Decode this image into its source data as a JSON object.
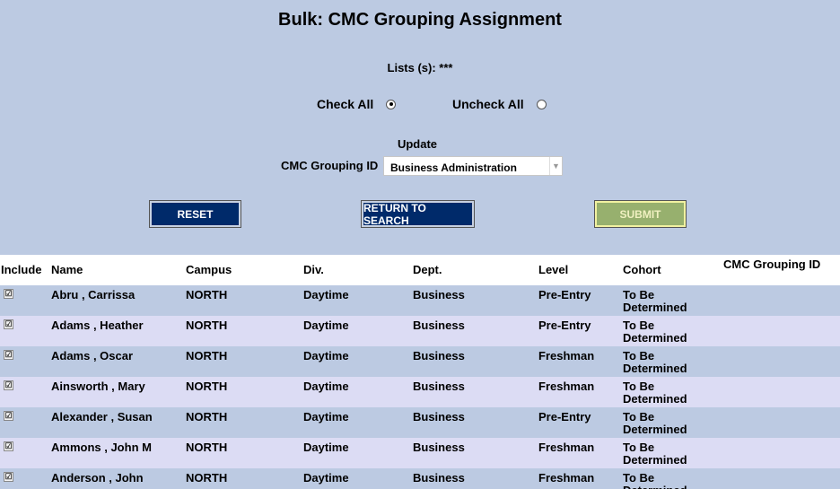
{
  "page": {
    "title": "Bulk: CMC Grouping Assignment"
  },
  "lists": {
    "label": "Lists (s): ***"
  },
  "check": {
    "check_all": "Check All",
    "uncheck_all": "Uncheck All",
    "selected": "check_all"
  },
  "update": {
    "label": "Update",
    "field_label": "CMC Grouping ID",
    "selected_value": "Business Administration"
  },
  "buttons": {
    "reset": "RESET",
    "return": "RETURN TO SEARCH",
    "submit": "SUBMIT"
  },
  "table": {
    "headers": {
      "include": "Include",
      "name": "Name",
      "campus": "Campus",
      "div": "Div.",
      "dept": "Dept.",
      "level": "Level",
      "cohort": "Cohort",
      "cmc": "CMC Grouping ID"
    },
    "check_glyph": "☑",
    "rows": [
      {
        "included": true,
        "name": "Abru , Carrissa",
        "campus": "NORTH",
        "div": "Daytime",
        "dept": "Business",
        "level": "Pre-Entry",
        "cohort_1": "To Be",
        "cohort_2": "Determined",
        "cmc": ""
      },
      {
        "included": true,
        "name": "Adams , Heather",
        "campus": "NORTH",
        "div": "Daytime",
        "dept": "Business",
        "level": "Pre-Entry",
        "cohort_1": "To Be",
        "cohort_2": "Determined",
        "cmc": ""
      },
      {
        "included": true,
        "name": "Adams , Oscar",
        "campus": "NORTH",
        "div": "Daytime",
        "dept": "Business",
        "level": "Freshman",
        "cohort_1": "To Be",
        "cohort_2": "Determined",
        "cmc": ""
      },
      {
        "included": true,
        "name": "Ainsworth , Mary",
        "campus": "NORTH",
        "div": "Daytime",
        "dept": "Business",
        "level": "Freshman",
        "cohort_1": "To Be",
        "cohort_2": "Determined",
        "cmc": ""
      },
      {
        "included": true,
        "name": "Alexander , Susan",
        "campus": "NORTH",
        "div": "Daytime",
        "dept": "Business",
        "level": "Pre-Entry",
        "cohort_1": "To Be",
        "cohort_2": "Determined",
        "cmc": ""
      },
      {
        "included": true,
        "name": "Ammons , John M",
        "campus": "NORTH",
        "div": "Daytime",
        "dept": "Business",
        "level": "Freshman",
        "cohort_1": "To Be",
        "cohort_2": "Determined",
        "cmc": ""
      },
      {
        "included": true,
        "name": "Anderson , John",
        "campus": "NORTH",
        "div": "Daytime",
        "dept": "Business",
        "level": "Freshman",
        "cohort_1": "To Be",
        "cohort_2": "Determined",
        "cmc": ""
      }
    ]
  }
}
